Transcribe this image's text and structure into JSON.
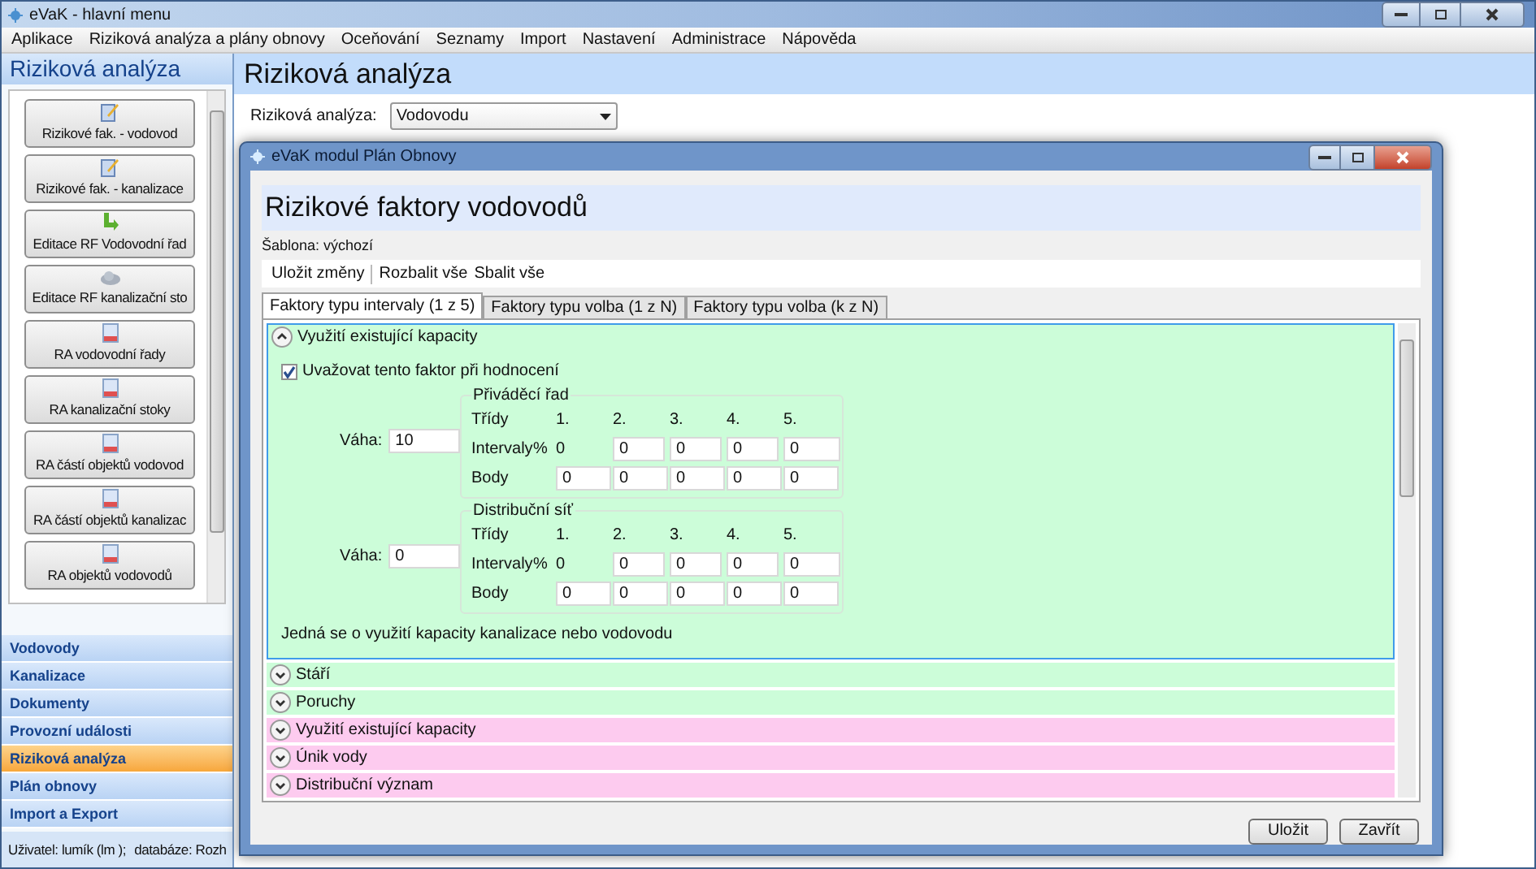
{
  "window": {
    "title": "eVaK - hlavní menu"
  },
  "menu": [
    "Aplikace",
    "Riziková analýza a plány obnovy",
    "Oceňování",
    "Seznamy",
    "Import",
    "Nastavení",
    "Administrace",
    "Nápověda"
  ],
  "sidebar": {
    "title": "Riziková analýza",
    "buttons": [
      {
        "label": "Rizikové fak. - vodovod",
        "kind": "edit"
      },
      {
        "label": "Rizikové fak. - kanalizace",
        "kind": "edit"
      },
      {
        "label": "Editace RF Vodovodní řad",
        "kind": "arrow"
      },
      {
        "label": "Editace RF kanalizační sto",
        "kind": "cloud"
      },
      {
        "label": "RA vodovodní řady",
        "kind": "doc"
      },
      {
        "label": "RA kanalizační stoky",
        "kind": "doc"
      },
      {
        "label": "RA částí objektů vodovod",
        "kind": "doc"
      },
      {
        "label": "RA částí objektů kanalizac",
        "kind": "doc"
      },
      {
        "label": "RA objektů vodovodů",
        "kind": "doc"
      }
    ],
    "nav": [
      {
        "label": "Vodovody",
        "selected": false
      },
      {
        "label": "Kanalizace",
        "selected": false
      },
      {
        "label": "Dokumenty",
        "selected": false
      },
      {
        "label": "Provozní události",
        "selected": false
      },
      {
        "label": "Riziková analýza",
        "selected": true
      },
      {
        "label": "Plán obnovy",
        "selected": false
      },
      {
        "label": "Import a Export",
        "selected": false
      }
    ]
  },
  "content": {
    "title": "Riziková analýza",
    "field_label": "Riziková analýza:",
    "select_value": "Vodovodu"
  },
  "status_bar": {
    "user": "Uživatel: lumík (lm );",
    "database": "databáze: Rozh"
  },
  "dialog": {
    "title": "eVaK modul Plán Obnovy",
    "heading": "Rizikové faktory vodovodů",
    "template": "Šablona: výchozí",
    "toolbar": [
      "Uložit změny",
      "Rozbalit vše",
      "Sbalit vše"
    ],
    "tabs": [
      {
        "label": "Faktory typu intervaly (1 z 5)",
        "selected": true
      },
      {
        "label": "Faktory typu volba (1 z N)",
        "selected": false
      },
      {
        "label": "Faktory typu volba (k z N)",
        "selected": false
      }
    ],
    "sections": [
      {
        "title": "Využití existující kapacity",
        "expanded": true,
        "color": "#ccfdd9",
        "checkbox": {
          "label": "Uvažovat tento faktor při hodnocení",
          "checked": true
        },
        "groups": [
          {
            "title": "Přiváděcí řad",
            "weight_label": "Váha:",
            "weight": "10",
            "row_labels": [
              "Třídy",
              "Intervaly",
              "Body"
            ],
            "percent": "%",
            "classes": [
              "1.",
              "2.",
              "3.",
              "4.",
              "5."
            ],
            "intervals": [
              "0",
              "0",
              "0",
              "0",
              "0"
            ],
            "points": [
              "0",
              "0",
              "0",
              "0",
              "0"
            ]
          },
          {
            "title": "Distribuční síť",
            "weight_label": "Váha:",
            "weight": "0",
            "row_labels": [
              "Třídy",
              "Intervaly",
              "Body"
            ],
            "percent": "%",
            "classes": [
              "1.",
              "2.",
              "3.",
              "4.",
              "5."
            ],
            "intervals": [
              "0",
              "0",
              "0",
              "0",
              "0"
            ],
            "points": [
              "0",
              "0",
              "0",
              "0",
              "0"
            ]
          }
        ],
        "note": "Jedná se o využití kapacity kanalizace nebo vodovodu"
      },
      {
        "title": "Stáří",
        "expanded": false,
        "color": "#ccfdd9"
      },
      {
        "title": "Poruchy",
        "expanded": false,
        "color": "#ccfdd9"
      },
      {
        "title": "Využití existující kapacity",
        "expanded": false,
        "color": "#fdcbef"
      },
      {
        "title": "Únik vody",
        "expanded": false,
        "color": "#fdcbef"
      },
      {
        "title": "Distribuční význam",
        "expanded": false,
        "color": "#fdcbef"
      }
    ],
    "buttons": [
      "Uložit",
      "Zavřít"
    ]
  }
}
